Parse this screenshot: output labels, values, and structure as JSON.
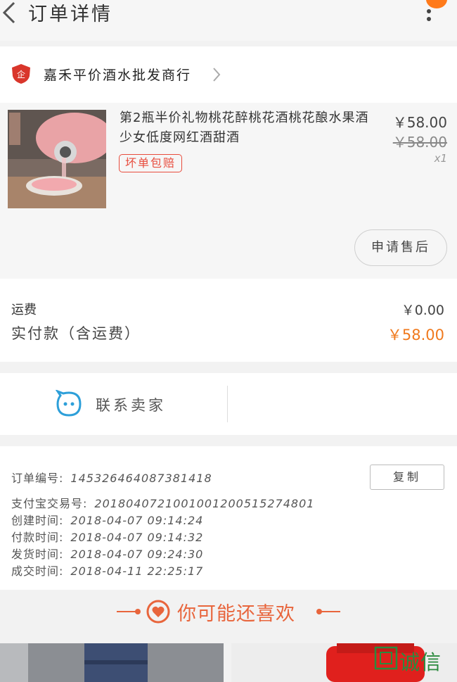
{
  "header": {
    "title": "订单详情",
    "back_icon": "chevron-left-icon",
    "more_icon": "more-vertical-icon"
  },
  "store": {
    "name": "嘉禾平价酒水批发商行",
    "icon": "enterprise-shield-icon",
    "icon_letter": "企"
  },
  "product": {
    "title": "第2瓶半价礼物桃花醉桃花酒桃花酿水果酒少女低度网红酒甜酒",
    "tag": "坏单包赔",
    "price": "￥58.00",
    "original_price": "￥58.00",
    "quantity": "x1",
    "after_sale_label": "申请售后"
  },
  "summary": {
    "shipping_label": "运费",
    "shipping_value": "￥0.00",
    "paid_label": "实付款（含运费）",
    "paid_value": "￥58.00"
  },
  "contact": {
    "label": "联系卖家"
  },
  "order": {
    "copy_label": "复制",
    "rows": [
      {
        "label": "订单编号:",
        "value": "145326464087381418"
      },
      {
        "label": "支付宝交易号:",
        "value": "2018040721001001200515274801"
      },
      {
        "label": "创建时间:",
        "value": "2018-04-07  09:14:24"
      },
      {
        "label": "付款时间:",
        "value": "2018-04-07  09:14:32"
      },
      {
        "label": "发货时间:",
        "value": "2018-04-07  09:24:30"
      },
      {
        "label": "成交时间:",
        "value": "2018-04-11  22:25:17"
      }
    ]
  },
  "recommend": {
    "title": "你可能还喜欢"
  },
  "watermark": {
    "text": "诚信"
  },
  "colors": {
    "accent": "#f07a1e",
    "tag_red": "#e84c3d",
    "chat_blue": "#2d9fd9",
    "recommend": "#e8653c"
  }
}
